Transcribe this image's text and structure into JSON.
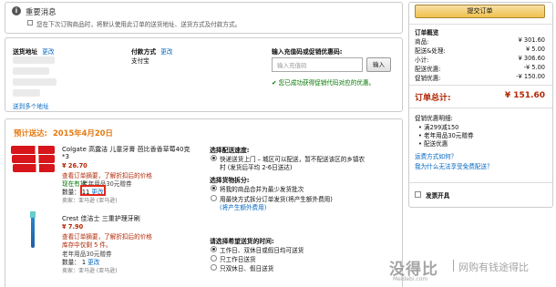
{
  "notice": {
    "title": "重要消息",
    "checkbox_text": "您在下次订购商品时，将默认使用此订单的送货地址、送货方式及付款方式。"
  },
  "address": {
    "ship_label": "送货地址",
    "edit": "更改",
    "send_multi": "送到多个地址",
    "payment_label": "付款方式",
    "payment_edit": "更改",
    "payment_value": "支付宝",
    "promo_label": "输入充值码或促销优惠码:",
    "promo_placeholder": "输入充值码",
    "promo_button": "输入",
    "promo_status": "您已成功获得促销代码对应的优惠。"
  },
  "shipment": {
    "eta_label": "预计送达:",
    "eta_date": "2015年4月20日",
    "items": [
      {
        "name_line1": "Colgate 高露洁 儿童牙膏 芭比香香草莓40克",
        "name_line2": "*3",
        "price": "¥ 26.70",
        "promo_link": "查看订单摘要，了解折扣后的价格",
        "stock": "现在有货",
        "gift": "老年用品30元赠券",
        "qty_label": "数量：",
        "qty": "11",
        "qty_edit": "更改",
        "seller": "卖家：亚马逊 (亚马逊)"
      },
      {
        "name_line1": "Crest 佳洁士 三重护理牙刷",
        "price": "¥ 7.90",
        "promo_link": "查看订单摘要，了解折扣后的价格",
        "stock": "库存中仅剩 5 件。",
        "gift": "老年用品30元赠券",
        "qty_label": "数量：",
        "qty": "1",
        "qty_edit": "更改",
        "seller": "卖家：亚马逊 (亚马逊)"
      }
    ],
    "speed": {
      "label": "选择配送速度:",
      "opt1_line1": "快递送货上门 – 城区可以配送，暂不配送该区的乡镇农",
      "opt1_line2": "村 (发货后平均 2-6日送达)"
    },
    "split": {
      "label": "选择货物拆分:",
      "opt1": "将我的商品合并为最少发货批次",
      "opt2_line1": "用最快方式拆分订单发货(将产生额外费用)",
      "opt2_line2": "(将产生额外费用)"
    },
    "time": {
      "label": "请选择希望送货的时间:",
      "opt1": "工作日、双休日或假日均可送货",
      "opt2": "只工作日送货",
      "opt3": "只双休日、假日送货"
    }
  },
  "summary": {
    "submit": "提交订单",
    "title": "订单概览",
    "rows": [
      {
        "label": "商品:",
        "value": "¥ 301.60"
      },
      {
        "label": "配送&处理:",
        "value": "¥ 5.00"
      },
      {
        "label": "小计:",
        "value": "¥ 306.60"
      },
      {
        "label": "配送优惠:",
        "value": "-¥ 5.00"
      },
      {
        "label": "促销优惠:",
        "value": "-¥ 150.00"
      }
    ],
    "total_label": "订单总计:",
    "total_value": "¥ 151.60",
    "promo_title": "促销优惠明细:",
    "promo_lines": [
      "满299减150",
      "老年用品30元赠券",
      "配送优惠"
    ],
    "link1": "运费方式如何？",
    "link2": "我为什么无法享受免费配送？",
    "gift_label": "发票开具"
  },
  "watermark": {
    "big": "没得比",
    "small": "Meidebi.com",
    "slogan": "网购有钱途得比"
  }
}
